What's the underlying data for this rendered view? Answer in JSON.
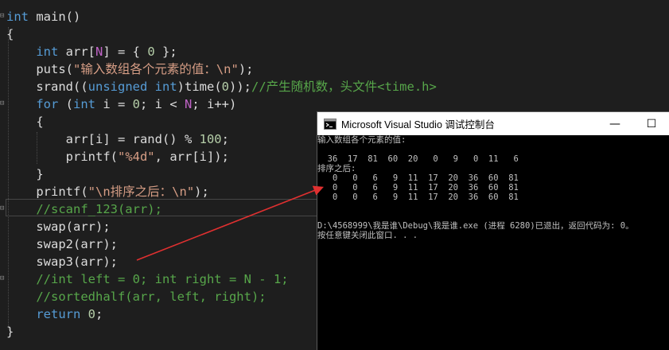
{
  "code": {
    "lines": [
      [
        {
          "t": "int",
          "c": "kw"
        },
        {
          "t": " main()",
          "c": ""
        }
      ],
      [
        {
          "t": "{",
          "c": ""
        }
      ],
      [
        {
          "t": "    ",
          "c": ""
        },
        {
          "t": "int",
          "c": "kw"
        },
        {
          "t": " arr[",
          "c": ""
        },
        {
          "t": "N",
          "c": "mac"
        },
        {
          "t": "] = { ",
          "c": ""
        },
        {
          "t": "0",
          "c": "num"
        },
        {
          "t": " };",
          "c": ""
        }
      ],
      [
        {
          "t": "    puts(",
          "c": ""
        },
        {
          "t": "\"输入数组各个元素的值：\\n\"",
          "c": "str"
        },
        {
          "t": ");",
          "c": ""
        }
      ],
      [
        {
          "t": "    srand((",
          "c": ""
        },
        {
          "t": "unsigned",
          "c": "kw"
        },
        {
          "t": " ",
          "c": ""
        },
        {
          "t": "int",
          "c": "kw"
        },
        {
          "t": ")time(",
          "c": ""
        },
        {
          "t": "0",
          "c": "num"
        },
        {
          "t": "));",
          "c": ""
        },
        {
          "t": "//产生随机数，头文件<time.h>",
          "c": "cm"
        }
      ],
      [
        {
          "t": "    ",
          "c": ""
        },
        {
          "t": "for",
          "c": "kw"
        },
        {
          "t": " (",
          "c": ""
        },
        {
          "t": "int",
          "c": "kw"
        },
        {
          "t": " i = ",
          "c": ""
        },
        {
          "t": "0",
          "c": "num"
        },
        {
          "t": "; i < ",
          "c": ""
        },
        {
          "t": "N",
          "c": "mac"
        },
        {
          "t": "; i++)",
          "c": ""
        }
      ],
      [
        {
          "t": "    {",
          "c": ""
        }
      ],
      [
        {
          "t": "        arr[i] = rand() % ",
          "c": ""
        },
        {
          "t": "100",
          "c": "num"
        },
        {
          "t": ";",
          "c": ""
        }
      ],
      [
        {
          "t": "        printf(",
          "c": ""
        },
        {
          "t": "\"%4d\"",
          "c": "str"
        },
        {
          "t": ", arr[i]);",
          "c": ""
        }
      ],
      [
        {
          "t": "    }",
          "c": ""
        }
      ],
      [
        {
          "t": "    printf(",
          "c": ""
        },
        {
          "t": "\"\\n排序之后：\\n\"",
          "c": "str"
        },
        {
          "t": ");",
          "c": ""
        }
      ],
      [
        {
          "t": "    ",
          "c": ""
        },
        {
          "t": "//scanf_123(arr);",
          "c": "cm"
        }
      ],
      [
        {
          "t": "    swap(arr);",
          "c": ""
        }
      ],
      [
        {
          "t": "    swap2(arr);",
          "c": ""
        }
      ],
      [
        {
          "t": "    swap3(arr);",
          "c": ""
        }
      ],
      [
        {
          "t": "    ",
          "c": ""
        },
        {
          "t": "//int left = 0; int right = N - 1;",
          "c": "cm"
        }
      ],
      [
        {
          "t": "    ",
          "c": ""
        },
        {
          "t": "//sortedhalf(arr, left, right);",
          "c": "cm"
        }
      ],
      [
        {
          "t": "    ",
          "c": ""
        },
        {
          "t": "return",
          "c": "kw"
        },
        {
          "t": " ",
          "c": ""
        },
        {
          "t": "0",
          "c": "num"
        },
        {
          "t": ";",
          "c": ""
        }
      ],
      [
        {
          "t": "}",
          "c": ""
        }
      ]
    ],
    "fold_markers": [
      "⊟",
      "⊟",
      "⊟",
      "⊟"
    ]
  },
  "console": {
    "title": "Microsoft Visual Studio 调试控制台",
    "minimize_glyph": "—",
    "maximize_glyph": "☐",
    "output_lines": [
      "输入数组各个元素的值:",
      "",
      "  36  17  81  60  20   0   9   0  11   6",
      "排序之后:",
      "   0   0   6   9  11  17  20  36  60  81",
      "   0   0   6   9  11  17  20  36  60  81",
      "   0   0   6   9  11  17  20  36  60  81",
      "",
      "",
      "D:\\4568999\\我是谁\\Debug\\我是谁.exe (进程 6280)已退出，返回代码为: 0。",
      "按任意键关闭此窗口. . ."
    ]
  },
  "colors": {
    "editor_bg": "#1e1e1e",
    "keyword": "#569cd6",
    "string": "#d69d85",
    "comment": "#57a64a",
    "macro": "#be63c5",
    "number": "#b5cea8",
    "arrow": "#e03030"
  }
}
